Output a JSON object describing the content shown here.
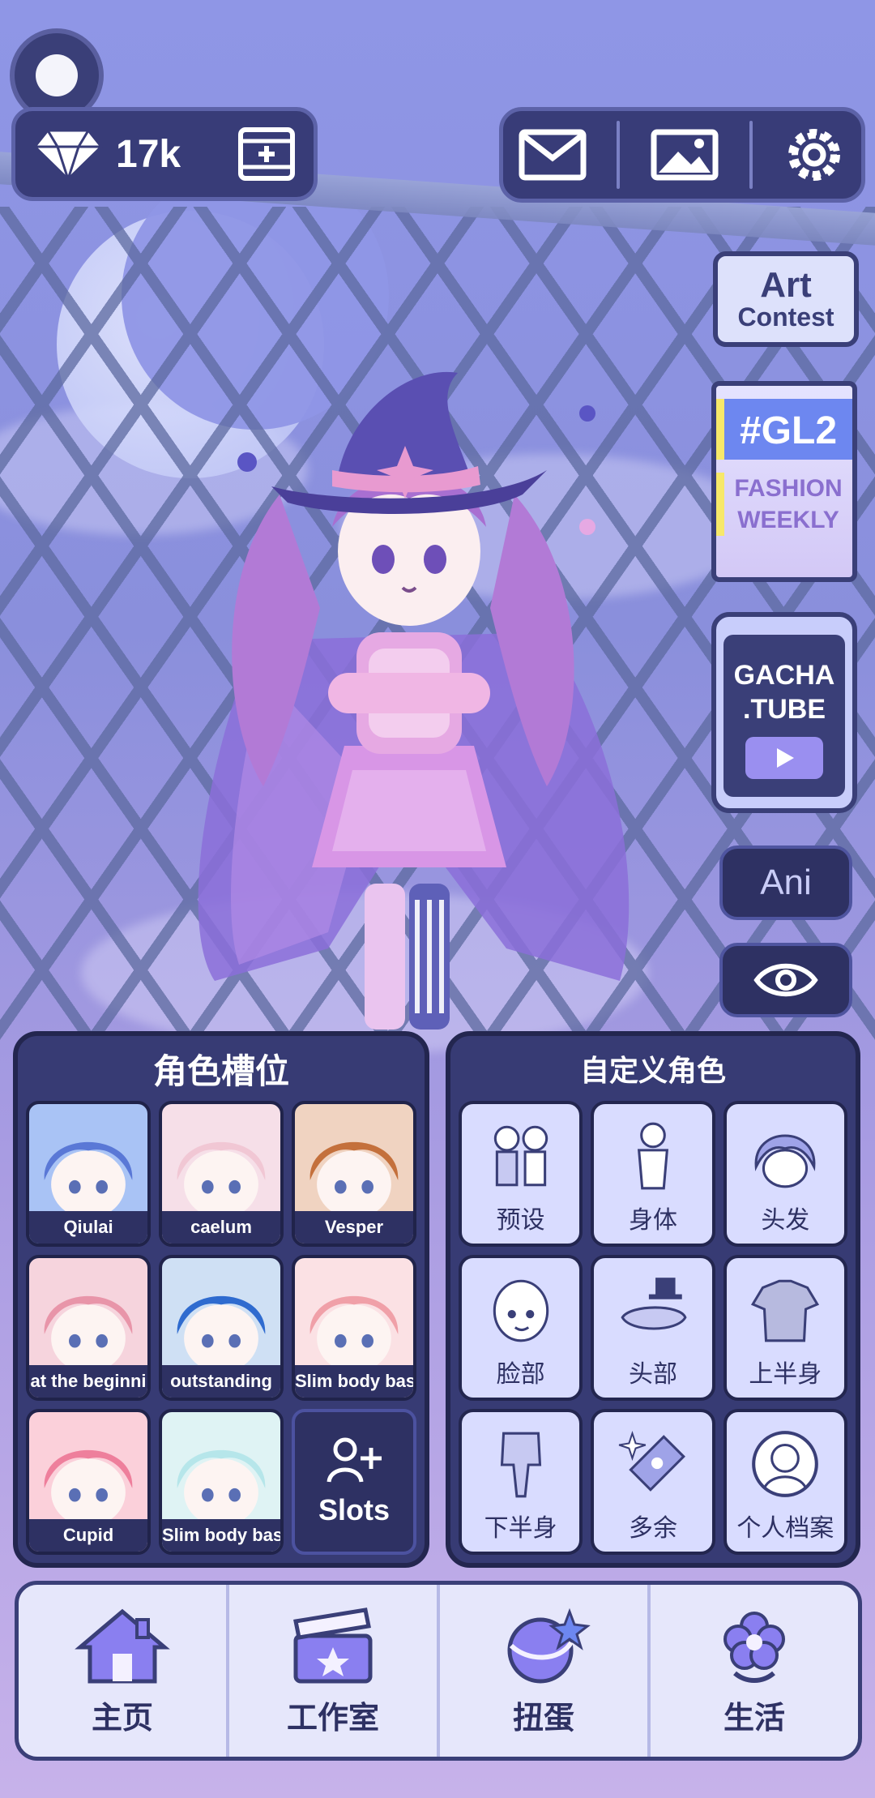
{
  "currency": {
    "gems": "17k"
  },
  "widgets": {
    "art_contest": {
      "line1": "Art",
      "line2": "Contest"
    },
    "gl2": {
      "tag": "#GL2",
      "line1": "FASHION",
      "line2": "WEEKLY"
    },
    "gacha_tube": {
      "line1": "GACHA",
      "line2": ".TUBE"
    },
    "ani": "Ani"
  },
  "slots_panel": {
    "title": "角色槽位",
    "slots": [
      {
        "name": "Qiulai",
        "color": "#a9c3f5",
        "hair": "#5a78d6"
      },
      {
        "name": "caelum",
        "color": "#f6dfe8",
        "hair": "#f1c7d4"
      },
      {
        "name": "Vesper",
        "color": "#f0d3c1",
        "hair": "#c4703c"
      },
      {
        "name": "at the beginni",
        "color": "#f6d4dd",
        "hair": "#e895a9"
      },
      {
        "name": "outstanding",
        "color": "#cfe0f4",
        "hair": "#2f6bcf"
      },
      {
        "name": "Slim body bas",
        "color": "#fbe1e4",
        "hair": "#f0a0a8"
      },
      {
        "name": "Cupid",
        "color": "#fbd0da",
        "hair": "#ee7f9c"
      },
      {
        "name": "Slim body bas",
        "color": "#dff3f4",
        "hair": "#b6e6ea"
      }
    ],
    "add_label": "Slots"
  },
  "custom_panel": {
    "title": "自定义角色",
    "items": [
      {
        "label": "预设",
        "icon": "preset-icon"
      },
      {
        "label": "身体",
        "icon": "body-icon"
      },
      {
        "label": "头发",
        "icon": "hair-icon"
      },
      {
        "label": "脸部",
        "icon": "face-icon"
      },
      {
        "label": "头部",
        "icon": "head-accessory-icon"
      },
      {
        "label": "上半身",
        "icon": "upper-body-icon"
      },
      {
        "label": "下半身",
        "icon": "lower-body-icon"
      },
      {
        "label": "多余",
        "icon": "extras-icon"
      },
      {
        "label": "个人档案",
        "icon": "profile-icon"
      }
    ]
  },
  "bottom_nav": [
    {
      "label": "主页",
      "icon": "house-icon"
    },
    {
      "label": "工作室",
      "icon": "clapperboard-icon"
    },
    {
      "label": "扭蛋",
      "icon": "gacha-ball-icon"
    },
    {
      "label": "生活",
      "icon": "flower-icon"
    }
  ],
  "colors": {
    "panel": "#373b74",
    "accent": "#6d87f0",
    "cell": "#d9dcff"
  }
}
